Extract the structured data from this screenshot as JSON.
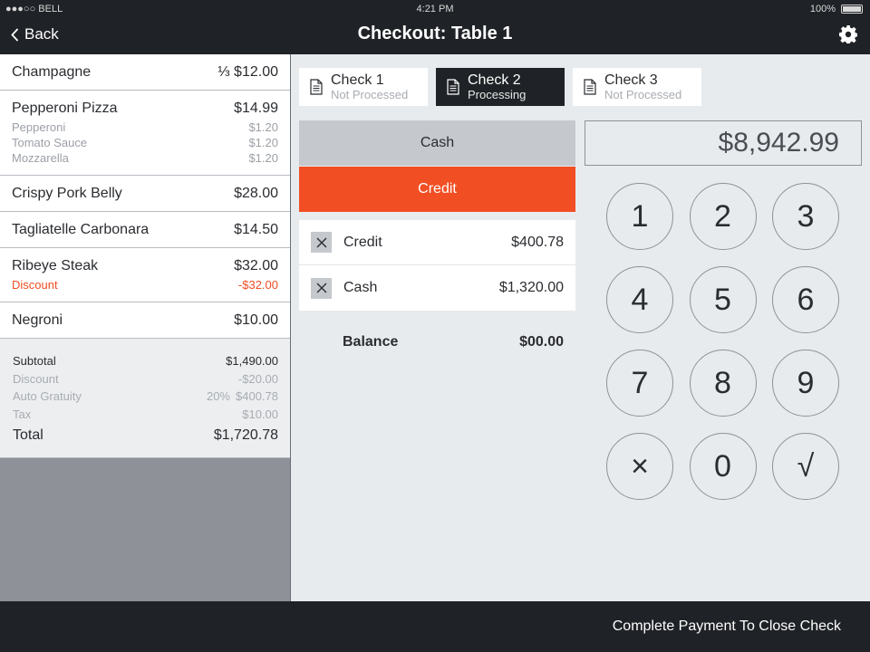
{
  "status_bar": {
    "carrier": "●●●○○ BELL",
    "time": "4:21 PM",
    "battery": "100%"
  },
  "nav": {
    "back_label": "Back",
    "title": "Checkout: Table 1"
  },
  "order": {
    "items": [
      {
        "name": "Champagne",
        "price": "⅓ $12.00",
        "subs": []
      },
      {
        "name": "Pepperoni Pizza",
        "price": "$14.99",
        "subs": [
          {
            "name": "Pepperoni",
            "price": "$1.20"
          },
          {
            "name": "Tomato Sauce",
            "price": "$1.20"
          },
          {
            "name": "Mozzarella",
            "price": "$1.20"
          }
        ]
      },
      {
        "name": "Crispy Pork Belly",
        "price": "$28.00",
        "subs": []
      },
      {
        "name": "Tagliatelle Carbonara",
        "price": "$14.50",
        "subs": []
      },
      {
        "name": "Ribeye Steak",
        "price": "$32.00",
        "subs": [
          {
            "name": "Discount",
            "price": "-$32.00"
          }
        ]
      },
      {
        "name": "Negroni",
        "price": "$10.00",
        "subs": []
      }
    ],
    "totals": {
      "subtotal_label": "Subtotal",
      "subtotal": "$1,490.00",
      "discount_label": "Discount",
      "discount": "-$20.00",
      "gratuity_label": "Auto Gratuity",
      "gratuity_pct": "20%",
      "gratuity": "$400.78",
      "tax_label": "Tax",
      "tax": "$10.00",
      "total_label": "Total",
      "total": "$1,720.78"
    }
  },
  "checks": [
    {
      "name": "Check 1",
      "state": "Not Processed"
    },
    {
      "name": "Check 2",
      "state": "Processing"
    },
    {
      "name": "Check 3",
      "state": "Not Processed"
    }
  ],
  "payment_methods": {
    "cash": "Cash",
    "credit": "Credit"
  },
  "payments": [
    {
      "name": "Credit",
      "amount": "$400.78"
    },
    {
      "name": "Cash",
      "amount": "$1,320.00"
    }
  ],
  "balance": {
    "label": "Balance",
    "value": "$00.00"
  },
  "amount_display": "$8,942.99",
  "keypad": [
    "1",
    "2",
    "3",
    "4",
    "5",
    "6",
    "7",
    "8",
    "9",
    "×",
    "0",
    "√"
  ],
  "footer": {
    "complete_label": "Complete Payment To Close Check"
  },
  "colors": {
    "accent": "#f24e24",
    "dark": "#1f2226"
  }
}
